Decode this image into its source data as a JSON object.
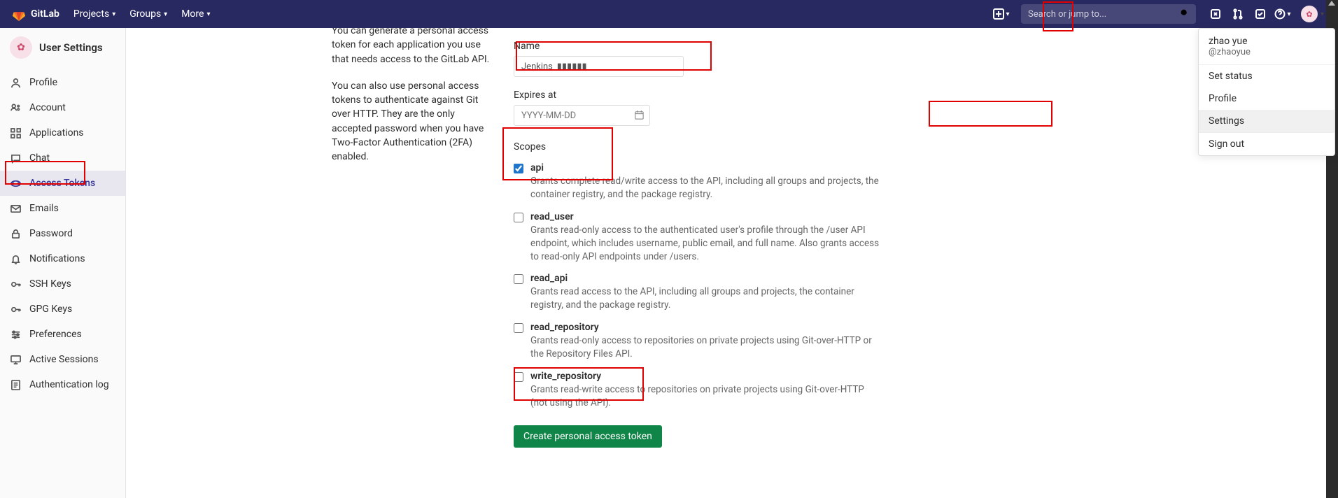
{
  "navbar": {
    "brand": "GitLab",
    "items": [
      "Projects",
      "Groups",
      "More"
    ],
    "search_placeholder": "Search or jump to..."
  },
  "sidebar": {
    "title": "User Settings",
    "items": [
      {
        "label": "Profile",
        "icon": "profile"
      },
      {
        "label": "Account",
        "icon": "account"
      },
      {
        "label": "Applications",
        "icon": "apps"
      },
      {
        "label": "Chat",
        "icon": "chat"
      },
      {
        "label": "Access Tokens",
        "icon": "token",
        "active": true
      },
      {
        "label": "Emails",
        "icon": "mail"
      },
      {
        "label": "Password",
        "icon": "lock"
      },
      {
        "label": "Notifications",
        "icon": "bell"
      },
      {
        "label": "SSH Keys",
        "icon": "key"
      },
      {
        "label": "GPG Keys",
        "icon": "key"
      },
      {
        "label": "Preferences",
        "icon": "prefs"
      },
      {
        "label": "Active Sessions",
        "icon": "session"
      },
      {
        "label": "Authentication log",
        "icon": "log"
      }
    ]
  },
  "intro": {
    "p1": "You can generate a personal access token for each application you use that needs access to the GitLab API.",
    "p2": "You can also use personal access tokens to authenticate against Git over HTTP. They are the only accepted password when you have Two-Factor Authentication (2FA) enabled."
  },
  "form": {
    "name_label": "Name",
    "name_value": "Jenkins_▮▮▮▮▮▮",
    "expires_label": "Expires at",
    "expires_placeholder": "YYYY-MM-DD",
    "scopes_label": "Scopes",
    "scopes": [
      {
        "name": "api",
        "checked": true,
        "desc": "Grants complete read/write access to the API, including all groups and projects, the container registry, and the package registry."
      },
      {
        "name": "read_user",
        "checked": false,
        "desc": "Grants read-only access to the authenticated user's profile through the /user API endpoint, which includes username, public email, and full name. Also grants access to read-only API endpoints under /users."
      },
      {
        "name": "read_api",
        "checked": false,
        "desc": "Grants read access to the API, including all groups and projects, the container registry, and the package registry."
      },
      {
        "name": "read_repository",
        "checked": false,
        "desc": "Grants read-only access to repositories on private projects using Git-over-HTTP or the Repository Files API."
      },
      {
        "name": "write_repository",
        "checked": false,
        "desc": "Grants read-write access to repositories on private projects using Git-over-HTTP (not using the API)."
      }
    ],
    "create_button": "Create personal access token"
  },
  "user_menu": {
    "display_name": "zhao yue",
    "handle": "@zhaoyue",
    "items": [
      "Set status",
      "Profile",
      "Settings",
      "Sign out"
    ],
    "highlighted": "Settings"
  }
}
